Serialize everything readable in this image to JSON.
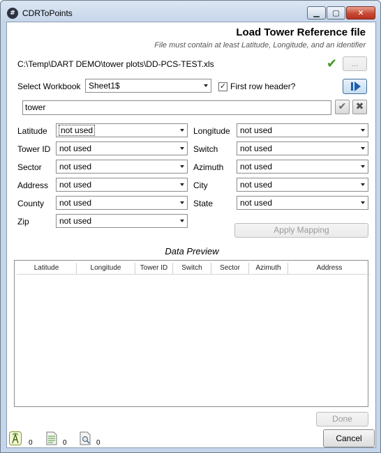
{
  "window": {
    "app_icon": "app-logo-icon",
    "app_icon_glyph": "#",
    "title": "CDRToPoints",
    "minimize_glyph": "▁",
    "maximize_glyph": "▢",
    "close_glyph": "✕"
  },
  "header": {
    "title": "Load Tower Reference file",
    "subtitle": "File must contain at least Latitude, Longitude, and an identifier"
  },
  "file": {
    "path": "C:\\Temp\\DART DEMO\\tower plots\\DD-PCS-TEST.xls",
    "valid_icon": "checkmark-icon",
    "valid_glyph": "✔",
    "browse_label": "..."
  },
  "workbook": {
    "label": "Select Workbook",
    "selected": "Sheet1$",
    "first_row_header_label": "First row header?",
    "first_row_header_checked": true,
    "check_glyph": "✓"
  },
  "filter": {
    "value": "tower",
    "apply_glyph": "✔",
    "clear_glyph": "✖"
  },
  "mapping": {
    "fields": [
      {
        "label": "Latitude",
        "value": "not used"
      },
      {
        "label": "Longitude",
        "value": "not used"
      },
      {
        "label": "Tower ID",
        "value": "not used"
      },
      {
        "label": "Switch",
        "value": "not used"
      },
      {
        "label": "Sector",
        "value": "not used"
      },
      {
        "label": "Azimuth",
        "value": "not used"
      },
      {
        "label": "Address",
        "value": "not used"
      },
      {
        "label": "City",
        "value": "not used"
      },
      {
        "label": "County",
        "value": "not used"
      },
      {
        "label": "State",
        "value": "not used"
      },
      {
        "label": "Zip",
        "value": "not used"
      }
    ],
    "apply_label": "Apply Mapping"
  },
  "preview": {
    "title": "Data Preview",
    "columns": [
      "Latitude",
      "Longitude",
      "Tower ID",
      "Switch",
      "Sector",
      "Azimuth",
      "Address"
    ],
    "rows": []
  },
  "status": [
    {
      "icon": "tower-icon",
      "count": "0"
    },
    {
      "icon": "document-icon",
      "count": "0"
    },
    {
      "icon": "document-search-icon",
      "count": "0"
    }
  ],
  "buttons": {
    "done": "Done",
    "cancel": "Cancel"
  },
  "colors": {
    "accent": "#1f5fa8",
    "valid": "#3c9a1e",
    "close": "#c74a34"
  }
}
